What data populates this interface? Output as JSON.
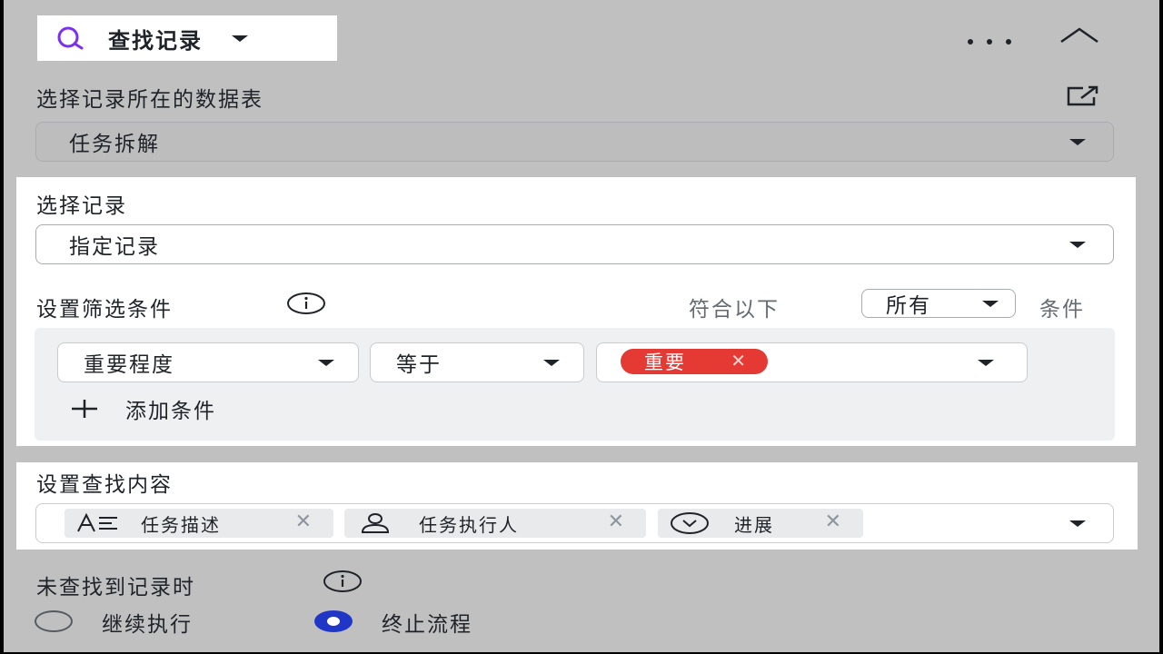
{
  "header": {
    "title": "查找记录"
  },
  "table_section": {
    "label": "选择记录所在的数据表",
    "value": "任务拆解"
  },
  "record_section": {
    "label": "选择记录",
    "value": "指定记录",
    "filter_label": "设置筛选条件",
    "match_prefix": "符合以下",
    "match_value": "所有",
    "match_suffix": "条件",
    "condition": {
      "field": "重要程度",
      "operator": "等于",
      "tag": "重要"
    },
    "add_condition": "添加条件"
  },
  "content_section": {
    "label": "设置查找内容",
    "fields": [
      "任务描述",
      "任务执行人",
      "进展"
    ]
  },
  "not_found": {
    "label": "未查找到记录时",
    "options": [
      "继续执行",
      "终止流程"
    ],
    "selected": "终止流程"
  },
  "colors": {
    "accent": "#7b2ff2",
    "tag_red": "#e53a34",
    "radio_selected": "#1f36c7"
  },
  "icons": [
    "search-icon",
    "more-icon",
    "collapse-icon",
    "external-link-icon",
    "info-icon",
    "plus-icon",
    "text-field-icon",
    "person-icon",
    "dropdown-circle-icon",
    "close-icon"
  ]
}
